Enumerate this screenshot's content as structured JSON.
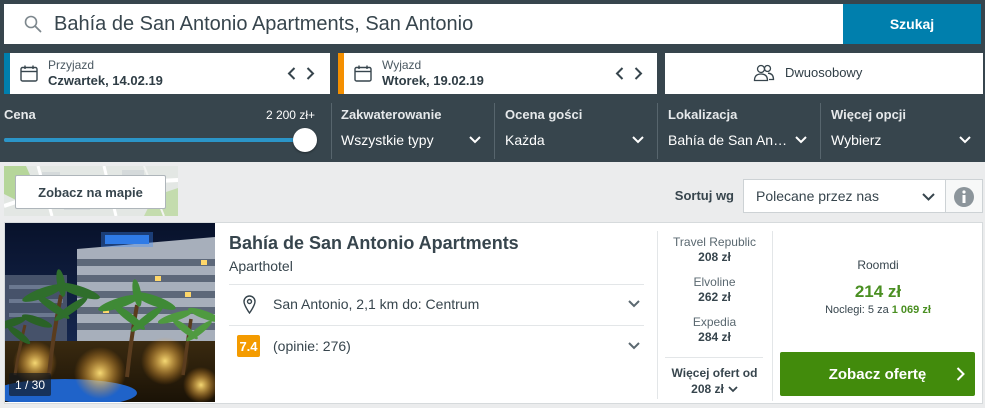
{
  "search": {
    "icon": "search-icon",
    "value": "Bahía de San Antonio Apartments, San Antonio",
    "button_label": "Szukaj"
  },
  "dates": {
    "checkin": {
      "label": "Przyjazd",
      "value": "Czwartek, 14.02.19",
      "icon": "calendar-icon"
    },
    "checkout": {
      "label": "Wyjazd",
      "value": "Wtorek, 19.02.19",
      "icon": "calendar-icon"
    }
  },
  "guests": {
    "icon": "users-icon",
    "label": "Dwuosobowy"
  },
  "filters": {
    "price": {
      "label": "Cena",
      "max_label": "2 200 zł+",
      "slider_fraction": 1.0
    },
    "accommodation": {
      "label": "Zakwaterowanie",
      "value": "Wszystkie typy"
    },
    "rating": {
      "label": "Ocena gości",
      "value": "Każda"
    },
    "location": {
      "label": "Lokalizacja",
      "value": "Bahía de San An…"
    },
    "more": {
      "label": "Więcej opcji",
      "value": "Wybierz"
    }
  },
  "toolbar": {
    "map_button": "Zobacz na mapie",
    "sort_label": "Sortuj wg",
    "sort_value": "Polecane przez nas",
    "info_icon": "info-icon"
  },
  "result": {
    "photo_counter": "1 / 30",
    "name": "Bahía de San Antonio Apartments",
    "type": "Aparthotel",
    "location_icon": "location-pin-icon",
    "location": "San Antonio, 2,1 km do: Centrum",
    "rating_score": "7.4",
    "rating_reviews": "(opinie: 276)",
    "offers": [
      {
        "provider": "Travel Republic",
        "price": "208 zł"
      },
      {
        "provider": "Elvoline",
        "price": "262 zł"
      },
      {
        "provider": "Expedia",
        "price": "284 zł"
      }
    ],
    "more_offers_label": "Więcej ofert od",
    "more_offers_price": "208 zł",
    "featured": {
      "provider": "Roomdi",
      "price": "214 zł",
      "nights_prefix": "Noclegi: 5 za",
      "total": "1 069 zł",
      "button": "Zobacz ofertę"
    }
  },
  "colors": {
    "header": "#37454d",
    "page_bg": "#ebeced",
    "accent": "#007fad",
    "checkout_accent": "#f48f00",
    "rating_badge": "#f49b00",
    "price_green": "#4a8f22",
    "cta_green": "#428b0c"
  }
}
